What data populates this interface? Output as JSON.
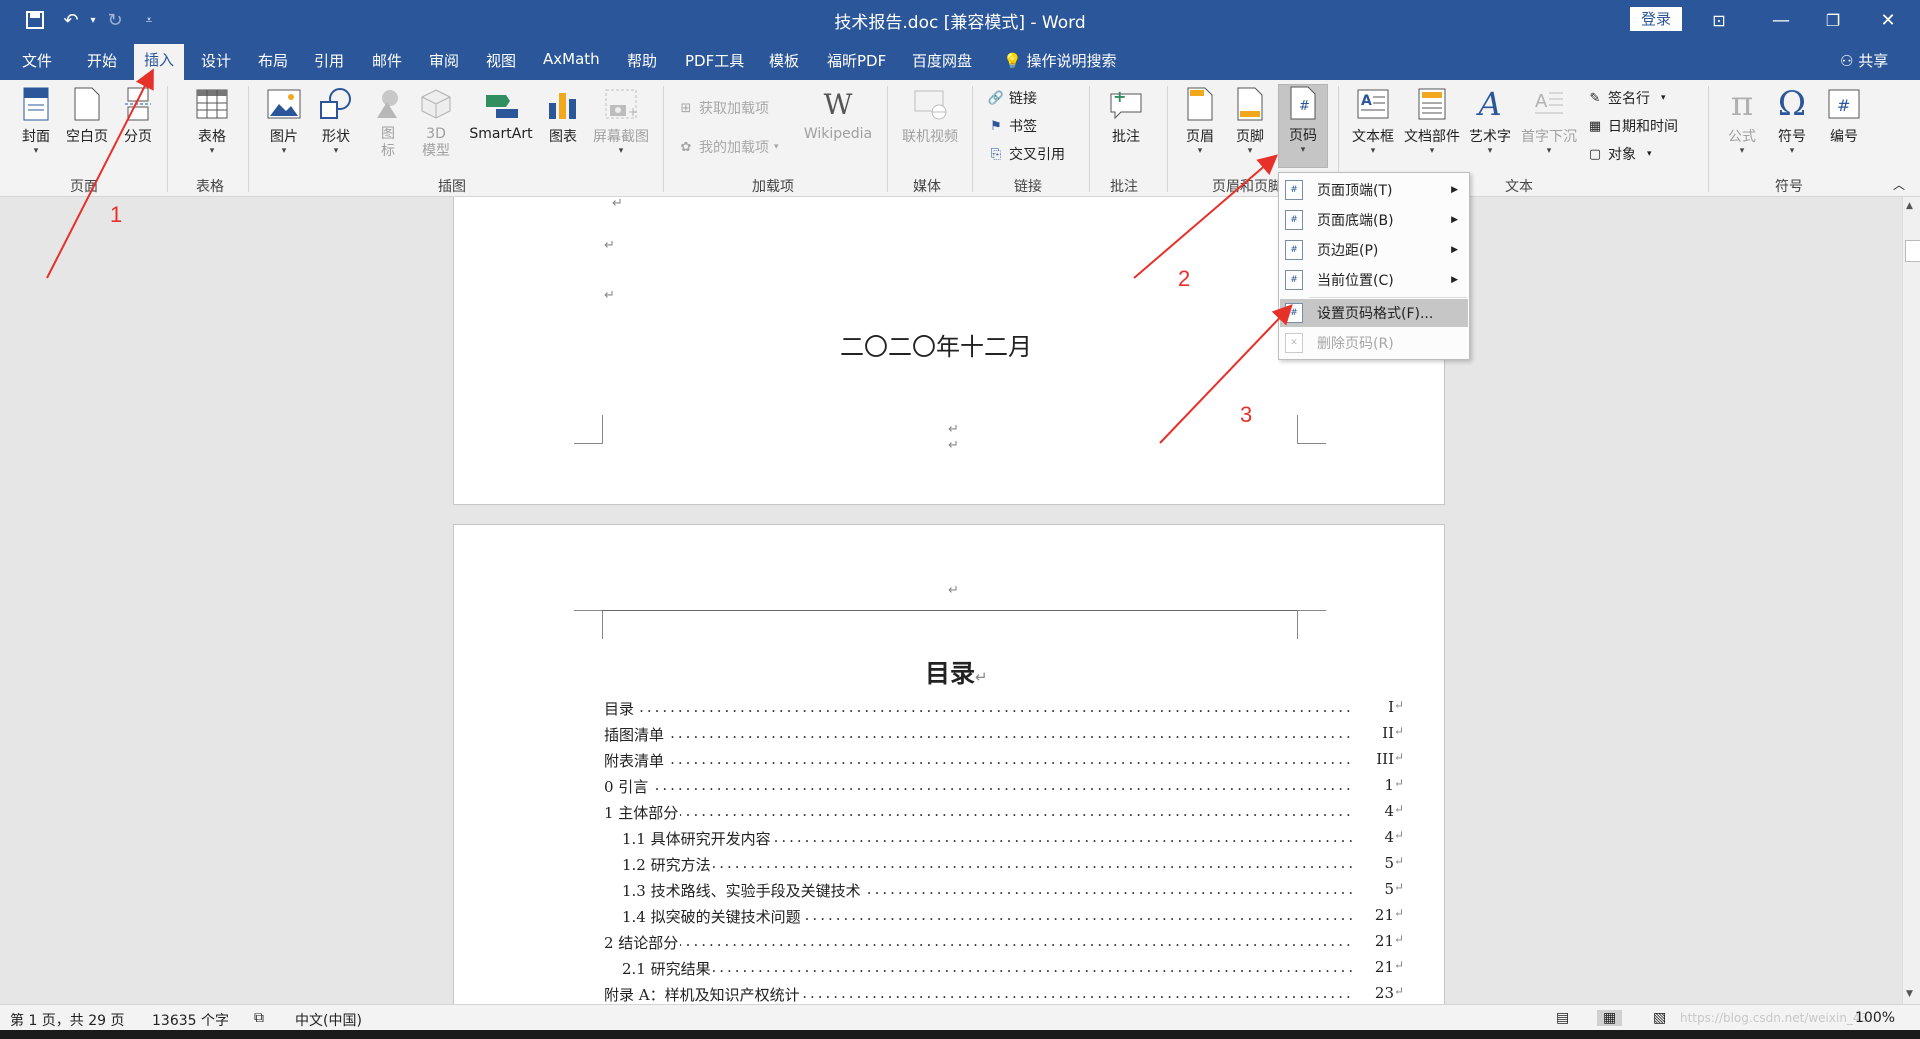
{
  "app": {
    "title": "技术报告.doc [兼容模式] - Word",
    "login": "登录",
    "share": "共享",
    "tell_me": "操作说明搜索"
  },
  "tabs": [
    "文件",
    "开始",
    "插入",
    "设计",
    "布局",
    "引用",
    "邮件",
    "审阅",
    "视图",
    "AxMath",
    "帮助",
    "PDF工具",
    "模板",
    "福昕PDF",
    "百度网盘"
  ],
  "active_tab": "插入",
  "ribbon": {
    "pages": {
      "cover": "封面",
      "blank": "空白页",
      "break": "分页",
      "group": "页面"
    },
    "tables": {
      "table": "表格",
      "group": "表格"
    },
    "illustrations": {
      "picture": "图片",
      "shapes": "形状",
      "icons": "图标",
      "model3d": "3D 模型",
      "smartart": "SmartArt",
      "chart": "图表",
      "screenshot": "屏幕截图",
      "group": "插图"
    },
    "addins": {
      "get": "获取加载项",
      "mine": "我的加载项",
      "wiki": "Wikipedia",
      "group": "加载项"
    },
    "media": {
      "video": "联机视频",
      "group": "媒体"
    },
    "links": {
      "link": "链接",
      "bookmark": "书签",
      "xref": "交叉引用",
      "group": "链接"
    },
    "comments": {
      "comment": "批注",
      "group": "批注"
    },
    "header_footer": {
      "header": "页眉",
      "footer": "页脚",
      "page_number": "页码",
      "group": "页眉和页脚"
    },
    "text": {
      "textbox": "文本框",
      "parts": "文档部件",
      "wordart": "艺术字",
      "dropcap": "首字下沉",
      "signature": "签名行",
      "datetime": "日期和时间",
      "object": "对象",
      "group": "文本"
    },
    "symbols": {
      "equation": "公式",
      "symbol": "符号",
      "number": "编号",
      "group": "符号"
    }
  },
  "menu": {
    "items": [
      {
        "label": "页面顶端(T)",
        "submenu": true
      },
      {
        "label": "页面底端(B)",
        "submenu": true
      },
      {
        "label": "页边距(P)",
        "submenu": true
      },
      {
        "label": "当前位置(C)",
        "submenu": true
      },
      {
        "label": "设置页码格式(F)...",
        "submenu": false
      },
      {
        "label": "删除页码(R)",
        "submenu": false
      }
    ]
  },
  "document": {
    "date_line": "二〇二〇年十二月",
    "para_mark": "↵",
    "toc_title": "目录",
    "toc": [
      {
        "text": "目录",
        "page": "I"
      },
      {
        "text": "插图清单",
        "page": "II"
      },
      {
        "text": "附表清单",
        "page": "III"
      },
      {
        "text": "0  引言",
        "page": "1"
      },
      {
        "text": "1  主体部分",
        "page": "4"
      },
      {
        "text": "1.1 具体研究开发内容",
        "page": "4"
      },
      {
        "text": "1.2 研究方法",
        "page": "5"
      },
      {
        "text": "1.3 技术路线、实验手段及关键技术",
        "page": "5"
      },
      {
        "text": "1.4 拟突破的关键技术问题",
        "page": "21"
      },
      {
        "text": "2  结论部分",
        "page": "21"
      },
      {
        "text": "2.1 研究结果",
        "page": "21"
      },
      {
        "text": "附录 A：样机及知识产权统计",
        "page": "23"
      }
    ]
  },
  "annotations": [
    "1",
    "2",
    "3"
  ],
  "status": {
    "page": "第 1 页，共 29 页",
    "words": "13635 个字",
    "lang": "中文(中国)",
    "zoom": "100%",
    "watermark": "https://blog.csdn.net/weixin_43..."
  },
  "colors": {
    "accent": "#2b579a",
    "annotation": "#e8302a"
  }
}
